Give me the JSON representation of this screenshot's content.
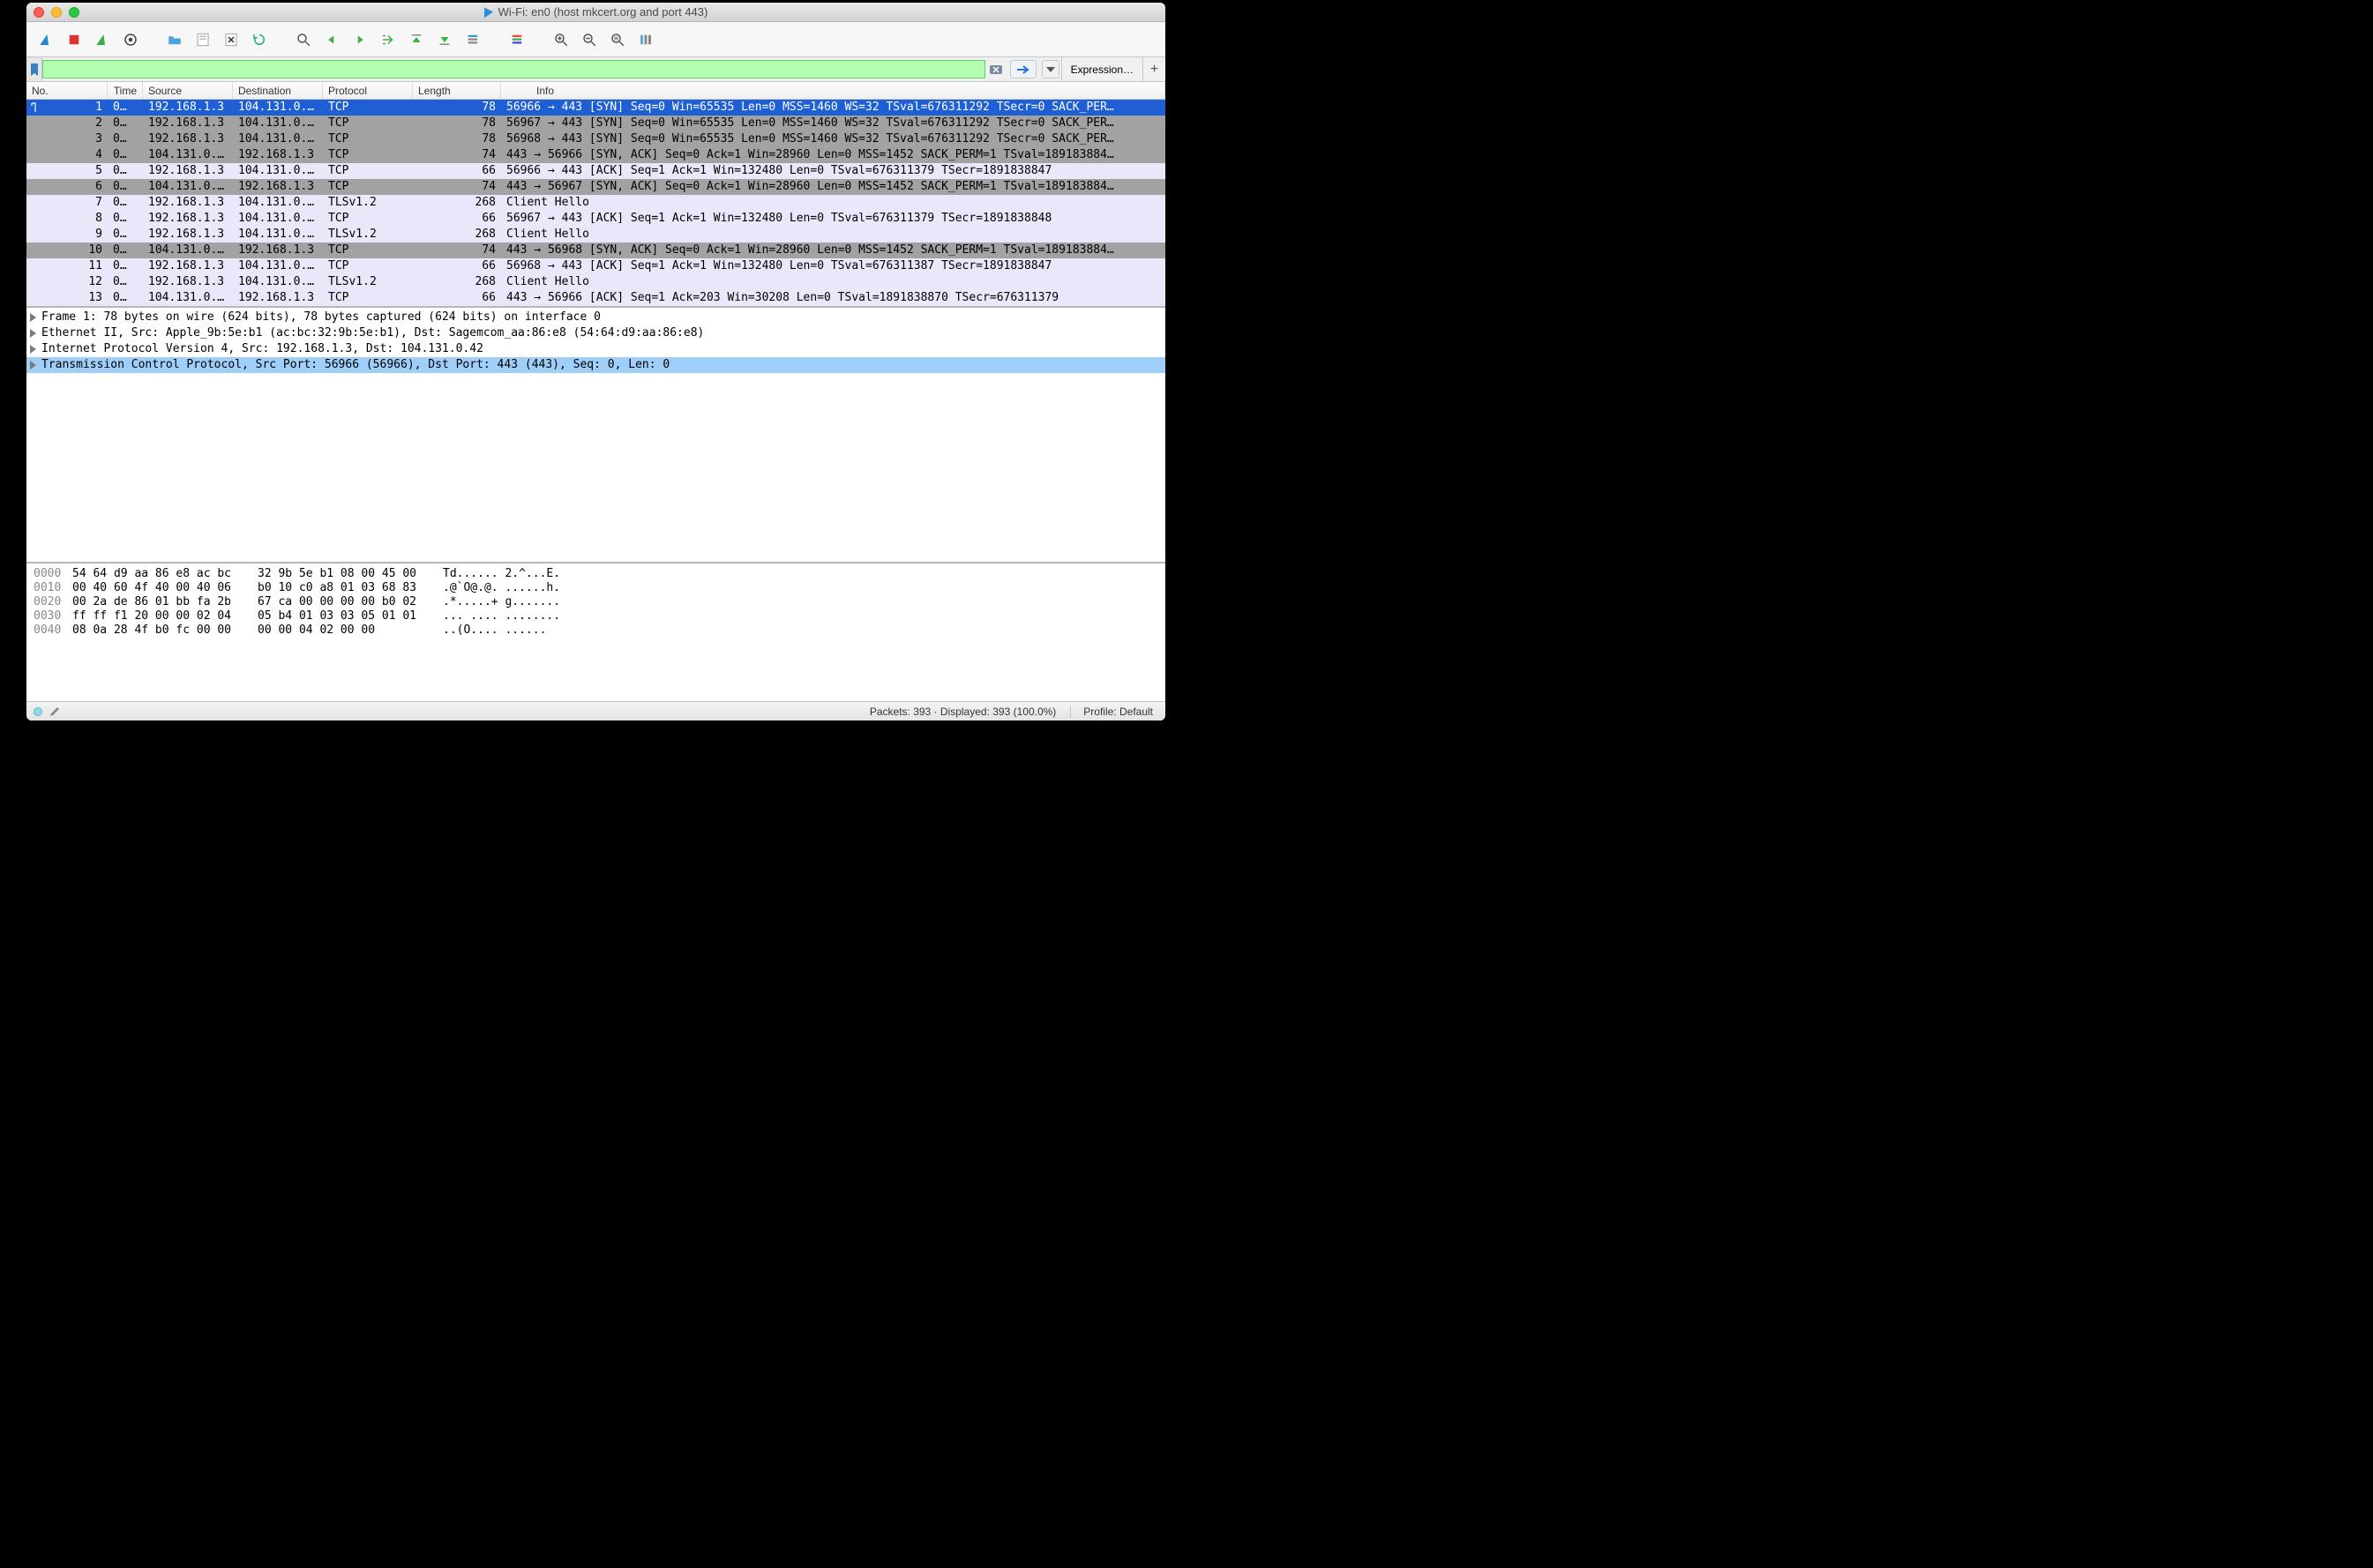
{
  "window": {
    "title": "Wi-Fi: en0 (host mkcert.org and port 443)"
  },
  "filter": {
    "expression_label": "Expression…"
  },
  "columns": {
    "no": "No.",
    "time": "Time",
    "source": "Source",
    "destination": "Destination",
    "protocol": "Protocol",
    "length": "Length",
    "info": "Info"
  },
  "packets": [
    {
      "no": "1",
      "time": "0…",
      "src": "192.168.1.3",
      "dst": "104.131.0.…",
      "proto": "TCP",
      "len": "78",
      "info": "56966 → 443 [SYN] Seq=0 Win=65535 Len=0 MSS=1460 WS=32 TSval=676311292 TSecr=0 SACK_PER…",
      "cls": "sel",
      "marker": true
    },
    {
      "no": "2",
      "time": "0…",
      "src": "192.168.1.3",
      "dst": "104.131.0.…",
      "proto": "TCP",
      "len": "78",
      "info": "56967 → 443 [SYN] Seq=0 Win=65535 Len=0 MSS=1460 WS=32 TSval=676311292 TSecr=0 SACK_PER…",
      "cls": "gray1"
    },
    {
      "no": "3",
      "time": "0…",
      "src": "192.168.1.3",
      "dst": "104.131.0.…",
      "proto": "TCP",
      "len": "78",
      "info": "56968 → 443 [SYN] Seq=0 Win=65535 Len=0 MSS=1460 WS=32 TSval=676311292 TSecr=0 SACK_PER…",
      "cls": "gray1"
    },
    {
      "no": "4",
      "time": "0…",
      "src": "104.131.0.…",
      "dst": "192.168.1.3",
      "proto": "TCP",
      "len": "74",
      "info": "443 → 56966 [SYN, ACK] Seq=0 Ack=1 Win=28960 Len=0 MSS=1452 SACK_PERM=1 TSval=189183884…",
      "cls": "gray1"
    },
    {
      "no": "5",
      "time": "0…",
      "src": "192.168.1.3",
      "dst": "104.131.0.…",
      "proto": "TCP",
      "len": "66",
      "info": "56966 → 443 [ACK] Seq=1 Ack=1 Win=132480 Len=0 TSval=676311379 TSecr=1891838847",
      "cls": "lav"
    },
    {
      "no": "6",
      "time": "0…",
      "src": "104.131.0.…",
      "dst": "192.168.1.3",
      "proto": "TCP",
      "len": "74",
      "info": "443 → 56967 [SYN, ACK] Seq=0 Ack=1 Win=28960 Len=0 MSS=1452 SACK_PERM=1 TSval=189183884…",
      "cls": "gray1"
    },
    {
      "no": "7",
      "time": "0…",
      "src": "192.168.1.3",
      "dst": "104.131.0.…",
      "proto": "TLSv1.2",
      "len": "268",
      "info": "Client Hello",
      "cls": "lav"
    },
    {
      "no": "8",
      "time": "0…",
      "src": "192.168.1.3",
      "dst": "104.131.0.…",
      "proto": "TCP",
      "len": "66",
      "info": "56967 → 443 [ACK] Seq=1 Ack=1 Win=132480 Len=0 TSval=676311379 TSecr=1891838848",
      "cls": "lav"
    },
    {
      "no": "9",
      "time": "0…",
      "src": "192.168.1.3",
      "dst": "104.131.0.…",
      "proto": "TLSv1.2",
      "len": "268",
      "info": "Client Hello",
      "cls": "lav"
    },
    {
      "no": "10",
      "time": "0…",
      "src": "104.131.0.…",
      "dst": "192.168.1.3",
      "proto": "TCP",
      "len": "74",
      "info": "443 → 56968 [SYN, ACK] Seq=0 Ack=1 Win=28960 Len=0 MSS=1452 SACK_PERM=1 TSval=189183884…",
      "cls": "gray1"
    },
    {
      "no": "11",
      "time": "0…",
      "src": "192.168.1.3",
      "dst": "104.131.0.…",
      "proto": "TCP",
      "len": "66",
      "info": "56968 → 443 [ACK] Seq=1 Ack=1 Win=132480 Len=0 TSval=676311387 TSecr=1891838847",
      "cls": "lav"
    },
    {
      "no": "12",
      "time": "0…",
      "src": "192.168.1.3",
      "dst": "104.131.0.…",
      "proto": "TLSv1.2",
      "len": "268",
      "info": "Client Hello",
      "cls": "lav"
    },
    {
      "no": "13",
      "time": "0…",
      "src": "104.131.0.…",
      "dst": "192.168.1.3",
      "proto": "TCP",
      "len": "66",
      "info": "443 → 56966 [ACK] Seq=1 Ack=203 Win=30208 Len=0 TSval=1891838870 TSecr=676311379",
      "cls": "lav"
    }
  ],
  "details": [
    {
      "text": "Frame 1: 78 bytes on wire (624 bits), 78 bytes captured (624 bits) on interface 0",
      "hl": false
    },
    {
      "text": "Ethernet II, Src: Apple_9b:5e:b1 (ac:bc:32:9b:5e:b1), Dst: Sagemcom_aa:86:e8 (54:64:d9:aa:86:e8)",
      "hl": false
    },
    {
      "text": "Internet Protocol Version 4, Src: 192.168.1.3, Dst: 104.131.0.42",
      "hl": false
    },
    {
      "text": "Transmission Control Protocol, Src Port: 56966 (56966), Dst Port: 443 (443), Seq: 0, Len: 0",
      "hl": true
    }
  ],
  "hex": [
    {
      "off": "0000",
      "b1": "54 64 d9 aa 86 e8 ac bc",
      "b2": "32 9b 5e b1 08 00 45 00",
      "asc": "Td...... 2.^...E."
    },
    {
      "off": "0010",
      "b1": "00 40 60 4f 40 00 40 06",
      "b2": "b0 10 c0 a8 01 03 68 83",
      "asc": ".@`O@.@. ......h."
    },
    {
      "off": "0020",
      "b1": "00 2a de 86 01 bb fa 2b",
      "b2": "67 ca 00 00 00 00 b0 02",
      "asc": ".*.....+ g......."
    },
    {
      "off": "0030",
      "b1": "ff ff f1 20 00 00 02 04",
      "b2": "05 b4 01 03 03 05 01 01",
      "asc": "... .... ........"
    },
    {
      "off": "0040",
      "b1": "08 0a 28 4f b0 fc 00 00",
      "b2": "00 00 04 02 00 00",
      "asc": "..(O.... ......"
    }
  ],
  "status": {
    "packets": "Packets: 393 · Displayed: 393 (100.0%)",
    "profile": "Profile: Default"
  }
}
